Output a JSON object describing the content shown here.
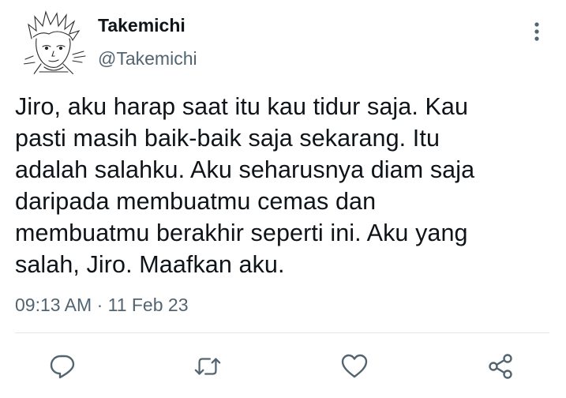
{
  "user": {
    "display_name": "Takemichi",
    "handle": "@Takemichi",
    "avatar_icon": "manga-avatar-icon"
  },
  "tweet": {
    "lines": [
      "Jiro, aku harap saat itu kau tidur saja. Kau",
      "pasti masih baik-baik saja sekarang. Itu",
      "adalah salahku. Aku seharusnya diam saja",
      "daripada membuatmu cemas dan",
      "membuatmu berakhir seperti ini. Aku yang",
      "salah, Jiro. Maafkan aku."
    ],
    "timestamp": "09:13 AM · 11 Feb 23"
  },
  "actions": {
    "reply_icon": "reply-icon",
    "retweet_icon": "retweet-icon",
    "like_icon": "heart-icon",
    "share_icon": "share-icon",
    "more_icon": "more-vertical-icon"
  },
  "colors": {
    "text": "#0f1419",
    "secondary": "#536471",
    "divider": "#e1e8ed"
  }
}
